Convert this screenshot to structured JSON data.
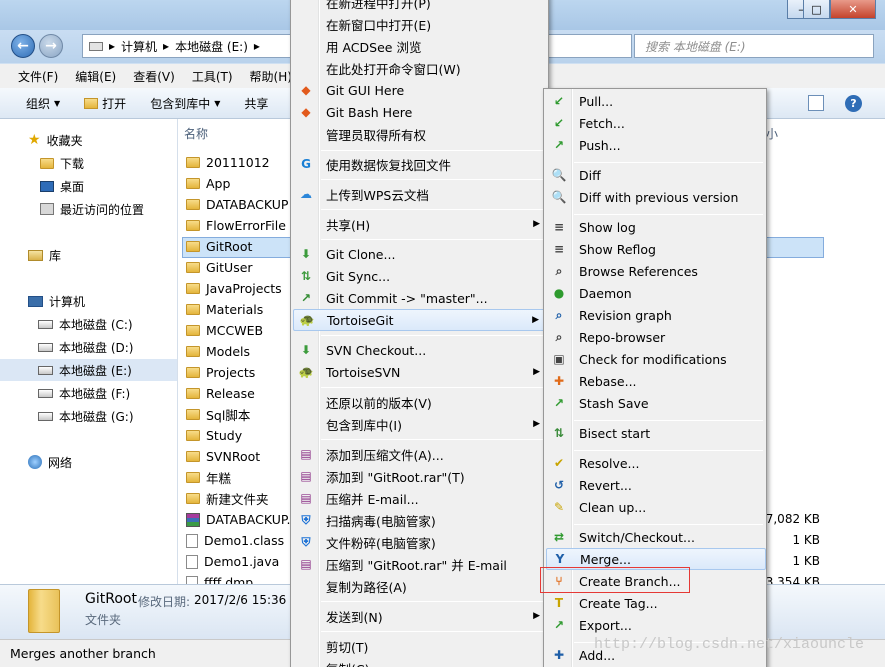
{
  "window": {
    "min_label": "–",
    "max_label": "□",
    "close_label": "✕"
  },
  "nav": {
    "back_icon": "back-arrow-icon",
    "forward_icon": "forward-arrow-icon",
    "address_parts": [
      "计算机",
      "本地磁盘 (E:)"
    ],
    "address_sep": "▸",
    "search_placeholder": "搜索 本地磁盘 (E:)"
  },
  "menubar": [
    "文件(F)",
    "编辑(E)",
    "查看(V)",
    "工具(T)",
    "帮助(H)"
  ],
  "toolbar": {
    "organize": "组织",
    "open": "打开",
    "include_library": "包含到库中",
    "share": "共享"
  },
  "navpane": {
    "favorites": "收藏夹",
    "downloads": "下载",
    "desktop": "桌面",
    "recent": "最近访问的位置",
    "libraries": "库",
    "computer": "计算机",
    "drives": [
      "本地磁盘 (C:)",
      "本地磁盘 (D:)",
      "本地磁盘 (E:)",
      "本地磁盘 (F:)",
      "本地磁盘 (G:)"
    ],
    "network": "网络"
  },
  "filepane": {
    "col_name": "名称",
    "col_size": "小",
    "folders": [
      "20111012",
      "App",
      "DATABACKUP",
      "FlowErrorFile",
      "GitRoot",
      "GitUser",
      "JavaProjects",
      "Materials",
      "MCCWEB",
      "Models",
      "Projects",
      "Release",
      "Sql脚本",
      "Study",
      "SVNRoot",
      "年糕",
      "新建文件夹"
    ],
    "files": [
      {
        "name": "DATABACKUP...",
        "size": "37,082 KB"
      },
      {
        "name": "Demo1.class",
        "size": "1 KB"
      },
      {
        "name": "Demo1.java",
        "size": "1 KB"
      },
      {
        "name": "ffff.dmp",
        "size": "3,354 KB"
      }
    ]
  },
  "details": {
    "name": "GitRoot",
    "modified_label": "修改日期:",
    "modified_value": "2017/2/6 15:36",
    "type": "文件夹"
  },
  "status": "Merges another branch",
  "context_menu": {
    "items": [
      {
        "label": "在新进程中打开(P)",
        "icon": ""
      },
      {
        "label": "在新窗口中打开(E)",
        "icon": ""
      },
      {
        "label": "用 ACDSee 浏览",
        "icon": ""
      },
      {
        "label": "在此处打开命令窗口(W)",
        "icon": ""
      },
      {
        "label": "Git GUI Here",
        "icon": "git-gui-icon"
      },
      {
        "label": "Git Bash Here",
        "icon": "git-bash-icon"
      },
      {
        "label": "管理员取得所有权",
        "icon": ""
      },
      {
        "label": "使用数据恢复找回文件",
        "icon": "data-recovery-icon"
      },
      {
        "label": "上传到WPS云文档",
        "icon": "wps-cloud-icon"
      },
      {
        "label": "共享(H)",
        "icon": "",
        "arrow": true
      },
      {
        "label": "Git Clone...",
        "icon": "git-clone-icon"
      },
      {
        "label": "Git Sync...",
        "icon": "git-sync-icon"
      },
      {
        "label": "Git Commit -> \"master\"...",
        "icon": "git-commit-icon"
      },
      {
        "label": "TortoiseGit",
        "icon": "tortoisegit-icon",
        "arrow": true
      },
      {
        "label": "SVN Checkout...",
        "icon": "svn-checkout-icon"
      },
      {
        "label": "TortoiseSVN",
        "icon": "tortoisesvn-icon",
        "arrow": true
      },
      {
        "label": "还原以前的版本(V)",
        "icon": ""
      },
      {
        "label": "包含到库中(I)",
        "icon": "",
        "arrow": true
      },
      {
        "label": "添加到压缩文件(A)...",
        "icon": "winrar-icon"
      },
      {
        "label": "添加到 \"GitRoot.rar\"(T)",
        "icon": "winrar-icon"
      },
      {
        "label": "压缩并 E-mail...",
        "icon": "winrar-icon"
      },
      {
        "label": "扫描病毒(电脑管家)",
        "icon": "virus-scan-icon"
      },
      {
        "label": "文件粉碎(电脑管家)",
        "icon": "file-shred-icon"
      },
      {
        "label": "压缩到 \"GitRoot.rar\" 并 E-mail",
        "icon": "winrar-icon"
      },
      {
        "label": "复制为路径(A)",
        "icon": ""
      },
      {
        "label": "发送到(N)",
        "icon": "",
        "arrow": true
      },
      {
        "label": "剪切(T)",
        "icon": ""
      },
      {
        "label": "复制(C)",
        "icon": ""
      }
    ]
  },
  "submenu": {
    "items": [
      {
        "label": "Pull...",
        "icon": "pull-icon"
      },
      {
        "label": "Fetch...",
        "icon": "fetch-icon"
      },
      {
        "label": "Push...",
        "icon": "push-icon"
      },
      {
        "label": "Diff",
        "icon": "diff-icon"
      },
      {
        "label": "Diff with previous version",
        "icon": "diff-previous-icon"
      },
      {
        "label": "Show log",
        "icon": "show-log-icon"
      },
      {
        "label": "Show Reflog",
        "icon": "show-reflog-icon"
      },
      {
        "label": "Browse References",
        "icon": "browse-references-icon"
      },
      {
        "label": "Daemon",
        "icon": "daemon-icon"
      },
      {
        "label": "Revision graph",
        "icon": "revision-graph-icon"
      },
      {
        "label": "Repo-browser",
        "icon": "repo-browser-icon"
      },
      {
        "label": "Check for modifications",
        "icon": "check-modifications-icon"
      },
      {
        "label": "Rebase...",
        "icon": "rebase-icon"
      },
      {
        "label": "Stash Save",
        "icon": "stash-save-icon"
      },
      {
        "label": "Bisect start",
        "icon": "bisect-icon"
      },
      {
        "label": "Resolve...",
        "icon": "resolve-icon"
      },
      {
        "label": "Revert...",
        "icon": "revert-icon"
      },
      {
        "label": "Clean up...",
        "icon": "cleanup-icon"
      },
      {
        "label": "Switch/Checkout...",
        "icon": "switch-checkout-icon"
      },
      {
        "label": "Merge...",
        "icon": "merge-icon"
      },
      {
        "label": "Create Branch...",
        "icon": "create-branch-icon"
      },
      {
        "label": "Create Tag...",
        "icon": "create-tag-icon"
      },
      {
        "label": "Export...",
        "icon": "export-icon"
      },
      {
        "label": "Add...",
        "icon": "add-icon"
      }
    ]
  },
  "watermark": "http://blog.csdn.net/xiaouncle"
}
